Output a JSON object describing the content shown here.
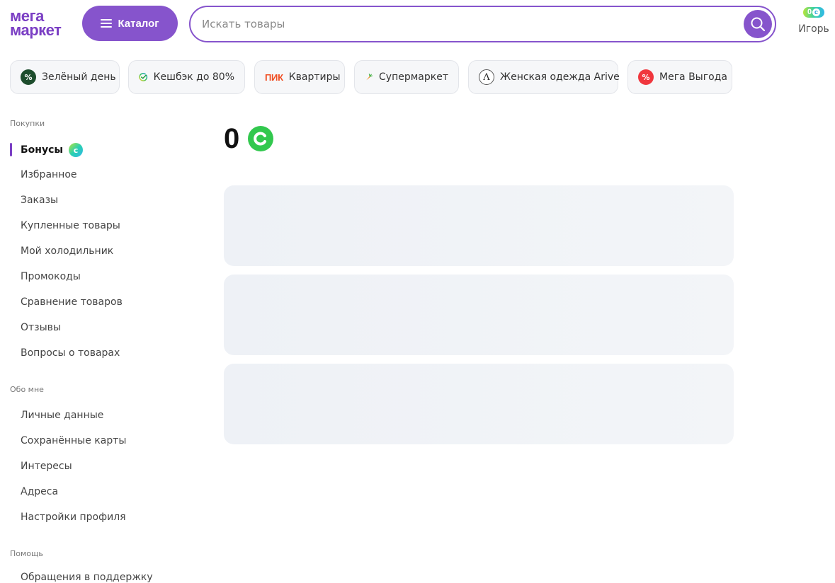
{
  "header": {
    "logo_line1": "мега",
    "logo_line2": "маркет",
    "catalog_label": "Каталог",
    "search_placeholder": "Искать товары",
    "user_bonus": "0",
    "user_name": "Игорь",
    "brand_color": "#8654cc"
  },
  "promo_chips": [
    {
      "label": "Зелёный день",
      "icon": "green-percent-icon"
    },
    {
      "label": "Кешбэк до 80%",
      "icon": "sber-check-icon"
    },
    {
      "label": "Квартиры",
      "icon": "pik-logo",
      "badge": "ПИК"
    },
    {
      "label": "Супермаркет",
      "icon": "carrot-icon"
    },
    {
      "label": "Женская одежда Arive",
      "icon": "arive-logo-icon"
    },
    {
      "label": "Мега Выгода",
      "icon": "red-percent-icon"
    }
  ],
  "sidebar": {
    "sections": [
      {
        "title": "Покупки",
        "items": [
          "Бонусы",
          "Избранное",
          "Заказы",
          "Купленные товары",
          "Мой холодильник",
          "Промокоды",
          "Сравнение товаров",
          "Отзывы",
          "Вопросы о товарах"
        ]
      },
      {
        "title": "Обо мне",
        "items": [
          "Личные данные",
          "Сохранённые карты",
          "Интересы",
          "Адреса",
          "Настройки профиля"
        ]
      },
      {
        "title": "Помощь",
        "items": [
          "Обращения в поддержку"
        ]
      }
    ],
    "active_item": "Бонусы"
  },
  "main": {
    "bonus_balance": "0",
    "bonus_color": "#32c84e"
  }
}
